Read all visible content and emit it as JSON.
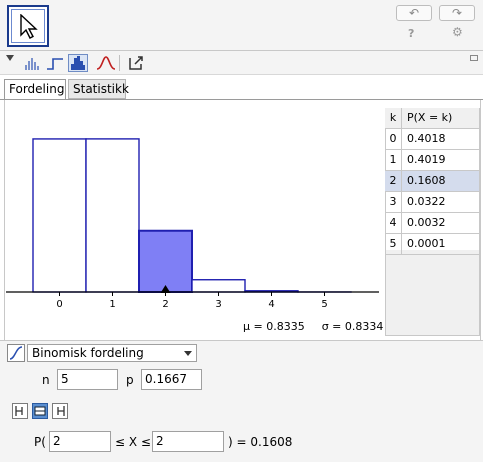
{
  "toolbar": {
    "selected_tool_icon": "arrow-pointer-icon",
    "undo_icon": "undo-icon",
    "redo_icon": "redo-icon",
    "help_label": "?",
    "settings_icon": "gear-icon"
  },
  "view_buttons": [
    {
      "icon": "histogram-lines-icon",
      "active": false
    },
    {
      "icon": "step-graph-icon",
      "active": false
    },
    {
      "icon": "bar-histogram-icon",
      "active": true
    },
    {
      "icon": "normal-curve-icon",
      "active": false
    },
    {
      "icon": "export-icon",
      "active": false
    }
  ],
  "tabs": [
    {
      "label": "Fordeling",
      "active": true
    },
    {
      "label": "Statistikk",
      "active": false
    }
  ],
  "chart_data": {
    "type": "bar",
    "categories": [
      "0",
      "1",
      "2",
      "3",
      "4",
      "5"
    ],
    "values": [
      0.4018,
      0.4019,
      0.1608,
      0.0322,
      0.0032,
      0.0001
    ],
    "highlighted": [
      2
    ],
    "marker_x": 2,
    "ylim": [
      0,
      0.42
    ],
    "title": "",
    "xlabel": "",
    "ylabel": ""
  },
  "stats": {
    "mu_label": "μ = 0.8335",
    "sigma_label": "σ = 0.8334"
  },
  "table": {
    "headers": [
      "k",
      "P(X = k)"
    ],
    "rows": [
      {
        "k": "0",
        "p": "0.4018"
      },
      {
        "k": "1",
        "p": "0.4019"
      },
      {
        "k": "2",
        "p": "0.1608",
        "selected": true
      },
      {
        "k": "3",
        "p": "0.0322"
      },
      {
        "k": "4",
        "p": "0.0032"
      },
      {
        "k": "5",
        "p": "0.0001"
      }
    ]
  },
  "distribution": {
    "selected": "Binomisk fordeling",
    "params": {
      "n_label": "n",
      "n_value": "5",
      "p_label": "p",
      "p_value": "0.1667"
    }
  },
  "interval_buttons": [
    {
      "icon": "left-sided-icon",
      "active": false
    },
    {
      "icon": "interval-icon",
      "active": true
    },
    {
      "icon": "right-sided-icon",
      "active": false
    }
  ],
  "probability": {
    "prefix": "P(",
    "lower": "2",
    "middle": "≤ X ≤",
    "upper": "2",
    "result": ") =  0.1608"
  },
  "colors": {
    "bar_stroke": "#1f1fb0",
    "bar_highlight": "#7f7ff5",
    "accent": "#1a3a8c"
  }
}
